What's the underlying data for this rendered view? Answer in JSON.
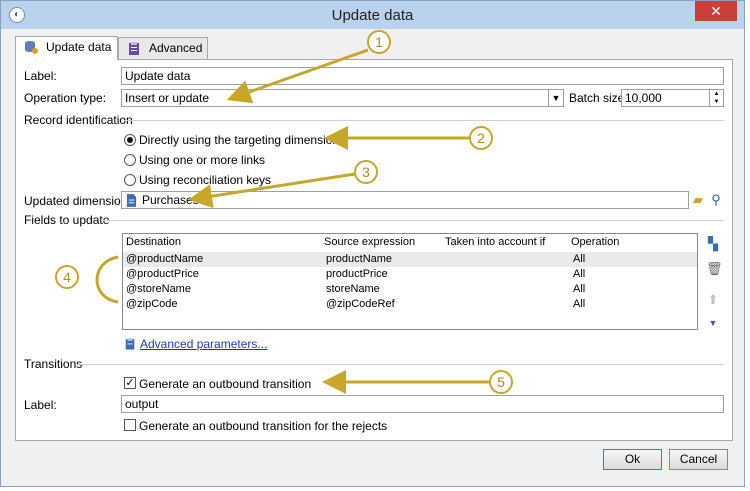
{
  "window": {
    "title": "Update data",
    "close_glyph": "✕"
  },
  "tabs": [
    {
      "label": "Update data",
      "icon": "database-update-icon"
    },
    {
      "label": "Advanced",
      "icon": "clipboard-icon"
    }
  ],
  "form": {
    "label_caption": "Label:",
    "label_value": "Update data",
    "operation_caption": "Operation type:",
    "operation_value": "Insert or update",
    "batch_caption": "Batch size:",
    "batch_value": "10,000",
    "record_section": "Record identification",
    "radio_direct": "Directly using the targeting dimension",
    "radio_links": "Using one or more links",
    "radio_keys": "Using reconciliation keys",
    "updated_dim_caption": "Updated dimension:",
    "updated_dim_value": "Purchases",
    "fields_section": "Fields to update"
  },
  "grid": {
    "headers": [
      "Destination",
      "Source expression",
      "Taken into account if",
      "Operation"
    ],
    "rows": [
      {
        "destination": "@productName",
        "source": "productName",
        "condition": "",
        "operation": "All"
      },
      {
        "destination": "@productPrice",
        "source": "productPrice",
        "condition": "",
        "operation": "All"
      },
      {
        "destination": "@storeName",
        "source": "storeName",
        "condition": "",
        "operation": "All"
      },
      {
        "destination": "@zipCode",
        "source": "@zipCodeRef",
        "condition": "",
        "operation": "All"
      }
    ]
  },
  "advanced_link": "Advanced parameters...",
  "transitions": {
    "section": "Transitions",
    "outbound_label": "Generate an outbound transition",
    "outbound_checked": true,
    "label_caption": "Label:",
    "label_value": "output",
    "rejects_label": "Generate an outbound transition for the rejects",
    "rejects_checked": false
  },
  "buttons": {
    "ok": "Ok",
    "cancel": "Cancel"
  },
  "callouts": [
    "1",
    "2",
    "3",
    "4",
    "5"
  ],
  "colors": {
    "callout": "#c8a62a",
    "titlebar": "#b9d2ee",
    "close": "#c7403a",
    "link": "#1a3fa8"
  }
}
